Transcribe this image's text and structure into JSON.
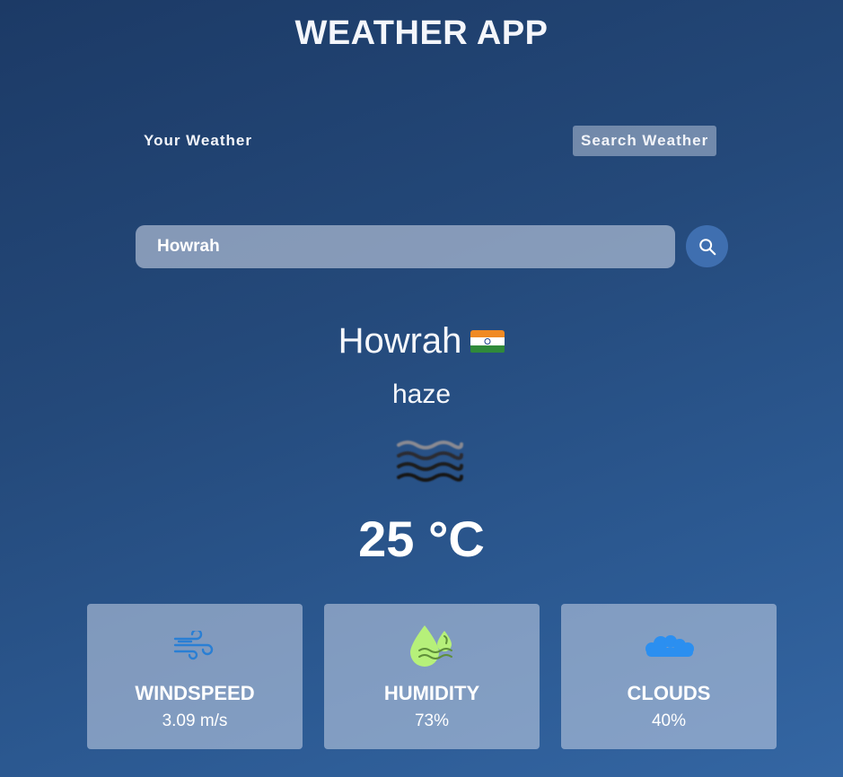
{
  "header": {
    "title": "WEATHER APP"
  },
  "tabs": {
    "your_weather": "Your Weather",
    "search_weather": "Search Weather",
    "active": "search_weather"
  },
  "search": {
    "value": "Howrah",
    "button_icon": "search-icon"
  },
  "weather": {
    "city": "Howrah",
    "country_flag": "india-flag-icon",
    "description": "haze",
    "icon": "haze-icon",
    "temperature": "25 °C"
  },
  "cards": {
    "windspeed": {
      "title": "WINDSPEED",
      "value": "3.09 m/s",
      "icon": "wind-icon"
    },
    "humidity": {
      "title": "HUMIDITY",
      "value": "73%",
      "icon": "humidity-icon"
    },
    "clouds": {
      "title": "CLOUDS",
      "value": "40%",
      "icon": "cloud-icon"
    }
  },
  "colors": {
    "background_top": "#1c3a66",
    "background_bottom": "#3466a3",
    "search_button": "#3f6fb0",
    "wind_icon": "#2a7fd4",
    "humidity_icon": "#b6f07a",
    "cloud_icon": "#2b8ff0"
  }
}
